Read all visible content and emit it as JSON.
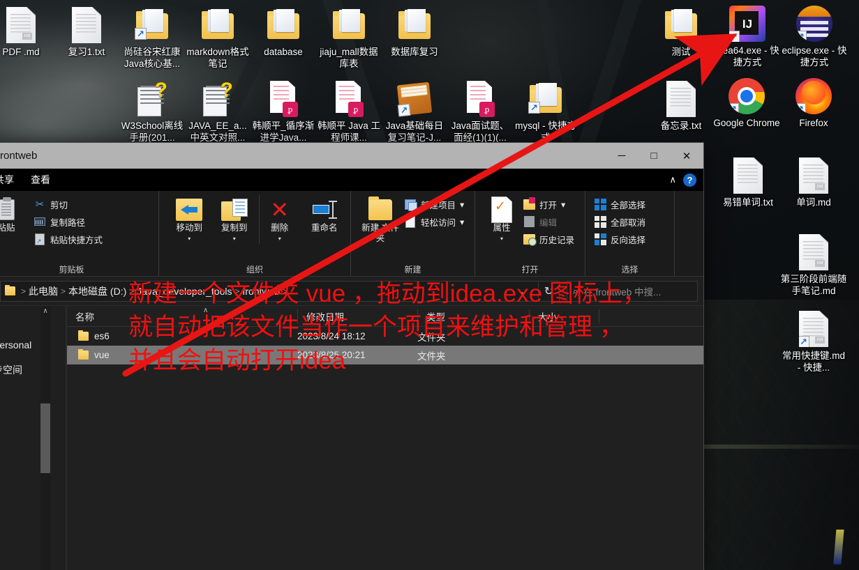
{
  "desktop": {
    "icons": [
      {
        "label": "PDF .md",
        "type": "md-file"
      },
      {
        "label": "复习1.txt",
        "type": "txt-file"
      },
      {
        "label": "尚硅谷宋红康Java核心基...",
        "type": "folder-shortcut"
      },
      {
        "label": "markdown格式笔记",
        "type": "folder"
      },
      {
        "label": "database",
        "type": "folder"
      },
      {
        "label": "jiaju_mall数据库表",
        "type": "folder"
      },
      {
        "label": "数据库复习",
        "type": "folder"
      },
      {
        "label": "测试",
        "type": "folder"
      },
      {
        "label": "idea64.exe - 快捷方式",
        "type": "intellij-shortcut"
      },
      {
        "label": "eclipse.exe - 快捷方式",
        "type": "eclipse-shortcut"
      },
      {
        "label": "W3School离线手册(201...",
        "type": "chm-file"
      },
      {
        "label": "JAVA_EE_a... 中英文对照...",
        "type": "chm-file"
      },
      {
        "label": "韩顺平_循序渐进学Java...",
        "type": "pdf-file"
      },
      {
        "label": "韩顺平 Java 工程师课...",
        "type": "pdf-file"
      },
      {
        "label": "Java基础每日复习笔记-J...",
        "type": "book-shortcut"
      },
      {
        "label": "Java面试题、面经(1)(1)(...",
        "type": "pdf-file"
      },
      {
        "label": "mysql - 快捷方式",
        "type": "folder-shortcut"
      },
      {
        "label": "备忘录.txt",
        "type": "txt-file"
      },
      {
        "label": "Google Chrome",
        "type": "chrome-shortcut"
      },
      {
        "label": "Firefox",
        "type": "firefox-shortcut"
      },
      {
        "label": "易错单词.txt",
        "type": "txt-file"
      },
      {
        "label": "单词.md",
        "type": "md-file"
      },
      {
        "label": "第三阶段前端随手笔记.md",
        "type": "md-file"
      },
      {
        "label": "常用快捷键.md - 快捷...",
        "type": "md-file-shortcut"
      }
    ]
  },
  "window": {
    "title": "rontweb",
    "controls": {
      "minimize": "─",
      "maximize": "□",
      "close": "✕"
    },
    "menu": {
      "items": [
        "共享",
        "查看"
      ],
      "collapse_caret": "∧",
      "help": "?"
    },
    "ribbon": {
      "groups": [
        {
          "label": "剪贴板",
          "big": [
            {
              "label": "粘贴",
              "icon": "clipboard-icon"
            }
          ],
          "small": [
            {
              "label": "剪切",
              "icon": "scissors-icon"
            },
            {
              "label": "复制路径",
              "icon": "copy-path-icon"
            },
            {
              "label": "粘贴快捷方式",
              "icon": "paste-shortcut-icon"
            }
          ]
        },
        {
          "label": "组织",
          "big": [
            {
              "label": "移动到",
              "icon": "move-to-icon",
              "caret": "▾"
            },
            {
              "label": "复制到",
              "icon": "copy-to-icon",
              "caret": "▾"
            },
            {
              "label": "删除",
              "icon": "delete-icon",
              "caret": "▾"
            },
            {
              "label": "重命名",
              "icon": "rename-icon"
            }
          ]
        },
        {
          "label": "新建",
          "big": [
            {
              "label": "新建 文件夹",
              "icon": "new-folder-icon"
            }
          ],
          "small": [
            {
              "label": "新建项目",
              "icon": "new-item-icon",
              "caret": "▾"
            },
            {
              "label": "轻松访问",
              "icon": "easy-access-icon",
              "caret": "▾"
            }
          ]
        },
        {
          "label": "打开",
          "big": [
            {
              "label": "属性",
              "icon": "properties-icon",
              "caret": "▾"
            }
          ],
          "small": [
            {
              "label": "打开",
              "icon": "open-icon",
              "caret": "▾"
            },
            {
              "label": "编辑",
              "icon": "edit-icon",
              "disabled": true
            },
            {
              "label": "历史记录",
              "icon": "history-icon"
            }
          ]
        },
        {
          "label": "选择",
          "small": [
            {
              "label": "全部选择",
              "icon": "select-all-icon"
            },
            {
              "label": "全部取消",
              "icon": "select-none-icon"
            },
            {
              "label": "反向选择",
              "icon": "invert-selection-icon"
            }
          ]
        }
      ]
    },
    "address": {
      "crumbs": [
        "此电脑",
        "本地磁盘 (D:)",
        "Java_developer_tools",
        "frontweb"
      ],
      "separator": ">",
      "dropdown_caret": "⌄",
      "refresh": "↻"
    },
    "search": {
      "placeholder": "在 frontweb 中搜...",
      "icon": "search-icon"
    },
    "nav": {
      "items": [
        "Personal",
        "步空间"
      ]
    },
    "list": {
      "columns": [
        "名称",
        "修改日期",
        "类型",
        "大小"
      ],
      "sort_indicator": "∧",
      "rows": [
        {
          "name": "es6",
          "date": "2023/8/24 18:12",
          "type": "文件夹",
          "size": "",
          "selected": false
        },
        {
          "name": "vue",
          "date": "2023/8/25 20:21",
          "type": "文件夹",
          "size": "",
          "selected": true
        }
      ]
    }
  },
  "annotation": {
    "color": "#f01010",
    "lines": [
      "新建一个文件夹 vue ，拖动到idea.exe 图标上，",
      "就自动把该文件当作一个项目来维护和管理 ，",
      "并且会自动打开idea"
    ],
    "arrow": {
      "from": "vue-folder-row",
      "to": "idea64-desktop-icon",
      "color": "#e81515"
    }
  }
}
